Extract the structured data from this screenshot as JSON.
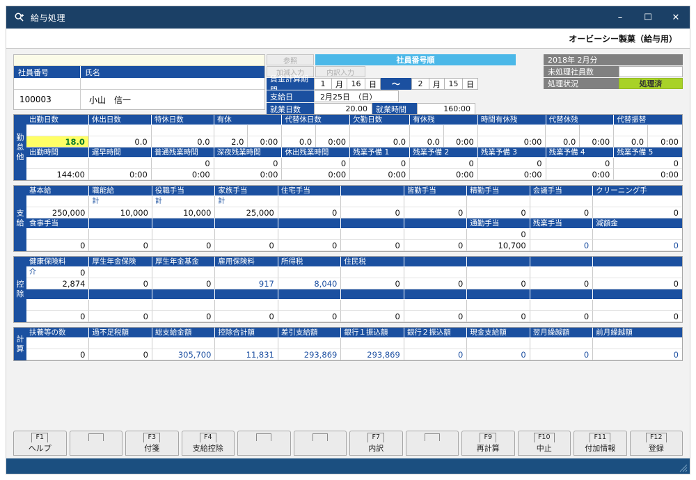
{
  "window": {
    "title": "給与処理",
    "app_icon": "magnifier-plus-icon",
    "minimize": "–",
    "maximize": "☐",
    "close": "✕"
  },
  "company": "オービーシー製菓（給与用）",
  "employee": {
    "headers": [
      "社員番号",
      "氏名"
    ],
    "number": "100003",
    "name": "小山　信一"
  },
  "period": {
    "btn_refer": "参照",
    "btn_kagen": "加減入力",
    "btn_uchiwake": "内訳入力",
    "sort_banner": "社員番号順",
    "calc_period_label": "賃金計算期間",
    "from_month": "1",
    "month_unit": "月",
    "from_day": "16",
    "day_unit": "日",
    "tilde": "～",
    "to_month": "2",
    "to_day": "15",
    "payday_label": "支給日",
    "payday_value": "2月25日　（日）",
    "workdays_label": "就業日数",
    "workdays_value": "20.00",
    "worktime_label": "就業時間",
    "worktime_value": "160:00"
  },
  "status": {
    "period": "2018年 2月分",
    "unprocessed_label": "未処理社員数",
    "unprocessed_value": "",
    "state_label": "処理状況",
    "state_value": "処理済",
    "state_color": "#a8d228"
  },
  "sections": {
    "attendance": {
      "label": "勤怠他",
      "row1_headers": [
        "出勤日数",
        "休出日数",
        "特休日数",
        "有休",
        "",
        "代替休日数",
        "",
        "欠勤日数",
        "有休残",
        "",
        "時間有休残",
        "代替休残",
        "",
        "代替振替",
        ""
      ],
      "row1_blank": [
        "",
        "",
        "",
        "",
        "",
        "",
        "",
        "",
        "",
        "",
        "",
        "",
        "",
        "",
        ""
      ],
      "row1_values": [
        "18.0",
        "0.0",
        "0.0",
        "2.0",
        "0:00",
        "0.0",
        "0:00",
        "0.0",
        "0.0",
        "0:00",
        "0:00",
        "0.0",
        "0:00",
        "0.0",
        "0:00"
      ],
      "row1_highlight_index": 0,
      "row2_headers": [
        "出勤時間",
        "遅早時間",
        "普通残業時間",
        "深夜残業時間",
        "休出残業時間",
        "残業予備 1",
        "残業予備 2",
        "残業予備 3",
        "残業予備 4",
        "残業予備 5"
      ],
      "row2_upper": [
        "",
        "",
        "0",
        "0",
        "0",
        "0",
        "0",
        "0",
        "0",
        "0"
      ],
      "row2_values": [
        "144:00",
        "0:00",
        "0:00",
        "0:00",
        "0:00",
        "0:00",
        "0:00",
        "0:00",
        "0:00",
        "0:00"
      ]
    },
    "payment": {
      "label": "支給",
      "row1_headers": [
        "基本給",
        "職能給",
        "役職手当",
        "家族手当",
        "住宅手当",
        "",
        "皆勤手当",
        "精勤手当",
        "会議手当",
        "クリーニング手"
      ],
      "row1_tags": [
        "",
        "計",
        "計",
        "計",
        "",
        "",
        "",
        "",
        "",
        ""
      ],
      "row1_values": [
        "250,000",
        "10,000",
        "10,000",
        "25,000",
        "0",
        "0",
        "0",
        "0",
        "0",
        "0"
      ],
      "row2_headers": [
        "食事手当",
        "",
        "",
        "",
        "",
        "",
        "",
        "通勤手当",
        "残業手当",
        "減額金"
      ],
      "row2_upper": [
        "",
        "",
        "",
        "",
        "",
        "",
        "",
        "0",
        "",
        ""
      ],
      "row2_values": [
        "0",
        "0",
        "0",
        "0",
        "0",
        "0",
        "0",
        "10,700",
        "0",
        "0"
      ],
      "row2_blue_indices": [
        8,
        9
      ]
    },
    "deduction": {
      "label": "控除",
      "row1_headers": [
        "健康保険料",
        "厚生年金保険",
        "厚生年金基金",
        "雇用保険料",
        "所得税",
        "住民税",
        "",
        "",
        "",
        ""
      ],
      "row1_kaigo_tag": "介",
      "row1_kaigo_value": "0",
      "row1_values": [
        "2,874",
        "0",
        "0",
        "917",
        "8,040",
        "0",
        "0",
        "0",
        "0",
        "0"
      ],
      "row1_blue_indices": [
        3,
        4
      ],
      "row2_headers": [
        "",
        "",
        "",
        "",
        "",
        "",
        "",
        "",
        "",
        ""
      ],
      "row2_values": [
        "0",
        "0",
        "0",
        "0",
        "0",
        "0",
        "0",
        "0",
        "0",
        "0"
      ]
    },
    "calculation": {
      "label": "計算",
      "headers": [
        "扶養等の数",
        "過不足税額",
        "総支給金額",
        "控除合計額",
        "差引支給額",
        "銀行１振込額",
        "銀行２振込額",
        "現金支給額",
        "翌月繰越額",
        "前月繰越額"
      ],
      "values": [
        "0",
        "0",
        "305,700",
        "11,831",
        "293,869",
        "293,869",
        "0",
        "0",
        "0",
        "0"
      ],
      "blue_indices": [
        2,
        3,
        4,
        5,
        6,
        7,
        8,
        9
      ]
    }
  },
  "function_keys": [
    {
      "key": "F1",
      "label": "ヘルプ",
      "enabled": true
    },
    {
      "key": "",
      "label": "",
      "enabled": false
    },
    {
      "key": "F3",
      "label": "付箋",
      "enabled": true
    },
    {
      "key": "F4",
      "label": "支給控除",
      "enabled": true
    },
    {
      "key": "",
      "label": "",
      "enabled": false
    },
    {
      "key": "",
      "label": "",
      "enabled": false
    },
    {
      "key": "F7",
      "label": "内訳",
      "enabled": true
    },
    {
      "key": "",
      "label": "",
      "enabled": false
    },
    {
      "key": "F9",
      "label": "再計算",
      "enabled": true
    },
    {
      "key": "F10",
      "label": "中止",
      "enabled": true
    },
    {
      "key": "F11",
      "label": "付加情報",
      "enabled": true
    },
    {
      "key": "F12",
      "label": "登録",
      "enabled": true
    }
  ]
}
